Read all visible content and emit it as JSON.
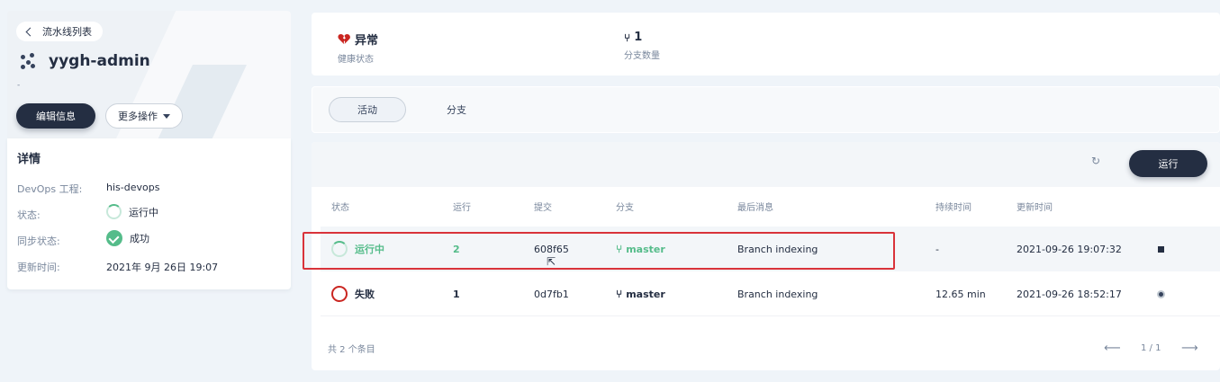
{
  "left_panel": {
    "back_label": "流水线列表",
    "title": "yygh-admin",
    "description": "-",
    "edit_button": "编辑信息",
    "more_button": "更多操作",
    "details": {
      "heading": "详情",
      "rows": [
        {
          "label": "DevOps 工程:",
          "value": "his-devops"
        },
        {
          "label": "状态:",
          "value": "运行中"
        },
        {
          "label": "同步状态:",
          "value": "成功"
        },
        {
          "label": "更新时间:",
          "value": "2021年 9月 26日 19:07"
        }
      ]
    }
  },
  "status_bar": {
    "health_value": "异常",
    "health_label": "健康状态",
    "branch_value": "1",
    "branch_label": "分支数量"
  },
  "tabs": [
    "活动",
    "分支"
  ],
  "toolbar": {
    "run_button": "运行"
  },
  "table": {
    "headers": [
      "状态",
      "运行",
      "提交",
      "分支",
      "最后消息",
      "持续时间",
      "更新时间"
    ],
    "rows": [
      {
        "status": "运行中",
        "run": "2",
        "commit": "608f65",
        "branch": "master",
        "message": "Branch indexing",
        "duration": "-",
        "updated": "2021-09-26 19:07:32"
      },
      {
        "status": "失败",
        "run": "1",
        "commit": "0d7fb1",
        "branch": "master",
        "message": "Branch indexing",
        "duration": "12.65 min",
        "updated": "2021-09-26 18:52:17"
      }
    ]
  },
  "footer": {
    "total": "共 2 个条目",
    "page": "1 / 1"
  },
  "colors": {
    "accent": "#242e42",
    "success": "#55bc8a",
    "error": "#ca2621",
    "highlight": "#d9333a"
  }
}
